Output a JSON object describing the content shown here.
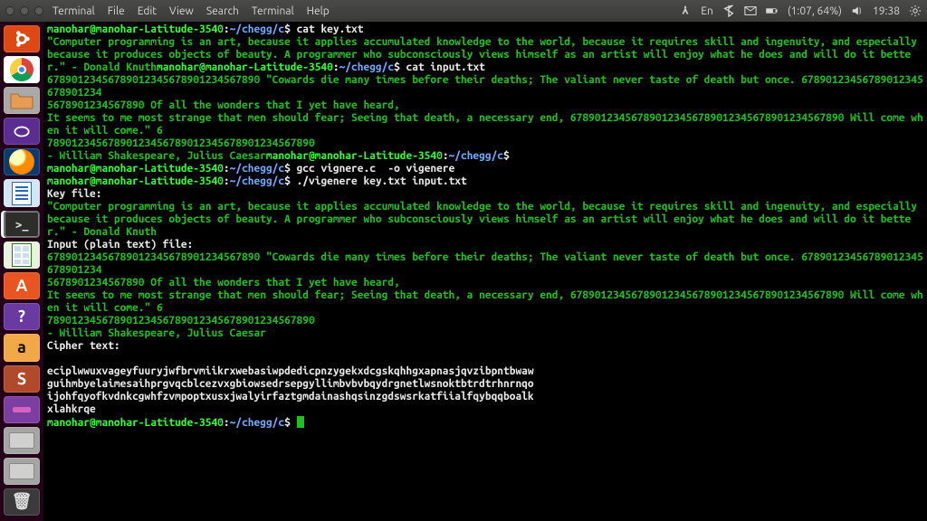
{
  "topbar": {
    "app": "Terminal",
    "menus": [
      "File",
      "Edit",
      "View",
      "Search",
      "Terminal",
      "Help"
    ],
    "tray": {
      "lang": "En",
      "battery": "(1:07, 64%)",
      "time": "19:38"
    }
  },
  "launcher": [
    {
      "name": "ubuntu-dash",
      "label": "⬡"
    },
    {
      "name": "chrome",
      "label": ""
    },
    {
      "name": "files",
      "label": ""
    },
    {
      "name": "shield",
      "label": ""
    },
    {
      "name": "firefox",
      "label": ""
    },
    {
      "name": "writer",
      "label": ""
    },
    {
      "name": "terminal",
      "label": ">_"
    },
    {
      "name": "calc",
      "label": ""
    },
    {
      "name": "software",
      "label": "A"
    },
    {
      "name": "help",
      "label": "?"
    },
    {
      "name": "amazon",
      "label": "a"
    },
    {
      "name": "sublime",
      "label": "S"
    },
    {
      "name": "screenshot",
      "label": ""
    },
    {
      "name": "disk1",
      "label": ""
    },
    {
      "name": "disk2",
      "label": ""
    },
    {
      "name": "trash",
      "label": "🗑"
    }
  ],
  "term": {
    "user": "manohar@manohar-Latitude-3540",
    "path": "~/chegg/c",
    "sep": ":",
    "dollar": "$",
    "cmd1": "cat key.txt",
    "key_txt": "\"Computer programming is an art, because it applies accumulated knowledge to the world, because it requires skill and ingenuity, and especially because it produces objects of beauty. A programmer who subconsciously views himself as an artist will enjoy what he does and will do it better.\" - Donald Knuth",
    "user_short": "manohar@manohar-Latitude-3540",
    "cmd2": "cat input.txt",
    "input_txt_l1": "67890123456789012345678901234567890 \"Cowards die many times before their deaths; The valiant never taste of death but once. 67890123456789012345678901234",
    "input_txt_l2": "5678901234567890 Of all the wonders that I yet have heard,",
    "input_txt_l3": "It seems to me most strange that men should fear; Seeing that death, a necessary end, 678901234567890123456789012345678901234567890 Will come when it will come.\" 6",
    "input_txt_l4": "78901234567890123456789012345678901234567890",
    "input_txt_l5": "- William Shakespeare, Julius Caesar",
    "cmd3": "gcc vignere.c  -o vigenere",
    "cmd4": "./vigenere key.txt input.txt",
    "h_key": "Key file:",
    "key_echo": "\"Computer programming is an art, because it applies accumulated knowledge to the world, because it requires skill and ingenuity, and especially because it produces objects of beauty. A programmer who subconsciously views himself as an artist will enjoy what he does and will do it better.\" - Donald Knuth",
    "h_in": "Input (plain text) file:",
    "in_echo_l1": "67890123456789012345678901234567890 \"Cowards die many times before their deaths; The valiant never taste of death but once. 67890123456789012345678901234",
    "in_echo_l2": "5678901234567890 Of all the wonders that I yet have heard,",
    "in_echo_l3": "It seems to me most strange that men should fear; Seeing that death, a necessary end, 678901234567890123456789012345678901234567890 Will come when it will come.\" 6",
    "in_echo_l4": "78901234567890123456789012345678901234567890",
    "in_echo_l5": "- William Shakespeare, Julius Caesar",
    "h_cipher": "Cipher text:",
    "cipher_l1": "eciplwwuxvageyfuuryjwfbrvmiikrxwebasiwpdedicpnzygekxdcgskqhhgxapnasjqvzibpntbwaw",
    "cipher_l2": "guihmbyelaimesaihprgvqcblcezvxgbiowsedrsepgyllimbvbvbqydrgnetlwsnoktbtrdtrhnrnqo",
    "cipher_l3": "ijohfqyofkvdnkcgwhfzvmpoptxusxjwalyirfaztgmdainashqsinzgdswsrkatfiialfqybqqboalk",
    "cipher_l4": "xlahkrqe"
  }
}
